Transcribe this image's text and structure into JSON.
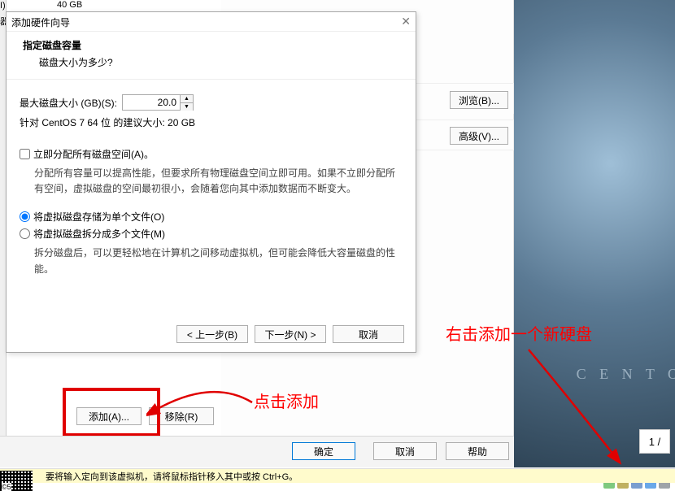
{
  "left": {
    "label1": "I)",
    "label2": "器",
    "device_size": "40 GB"
  },
  "settings": {
    "browse": "浏览(B)...",
    "advanced": "高级(V)...",
    "add": "添加(A)...",
    "remove": "移除(R)",
    "ok": "确定",
    "cancel": "取消",
    "help": "帮助"
  },
  "wizard": {
    "title": "添加硬件向导",
    "heading": "指定磁盘容量",
    "subheading": "磁盘大小为多少?",
    "max_label": "最大磁盘大小 (GB)(S):",
    "max_value": "20.0",
    "recommended": "针对 CentOS 7 64 位 的建议大小: 20 GB",
    "allocate_now": "立即分配所有磁盘空间(A)。",
    "allocate_desc": "分配所有容量可以提高性能，但要求所有物理磁盘空间立即可用。如果不立即分配所有空间，虚拟磁盘的空间最初很小，会随着您向其中添加数据而不断变大。",
    "single_file": "将虚拟磁盘存储为单个文件(O)",
    "multi_file": "将虚拟磁盘拆分成多个文件(M)",
    "multi_desc": "拆分磁盘后，可以更轻松地在计算机之间移动虚拟机，但可能会降低大容量磁盘的性能。",
    "back": "< 上一步(B)",
    "next": "下一步(N) >",
    "cancel": "取消"
  },
  "annotations": {
    "add_text": "点击添加",
    "right_click": "右击添加一个新硬盘"
  },
  "desktop": {
    "brand": "C  E  N  T  O",
    "pager": "1 /"
  },
  "status": {
    "text": "要将输入定向到该虚拟机，请将鼠标指针移入其中或按 Ctrl+G。",
    "qr": "©5"
  }
}
